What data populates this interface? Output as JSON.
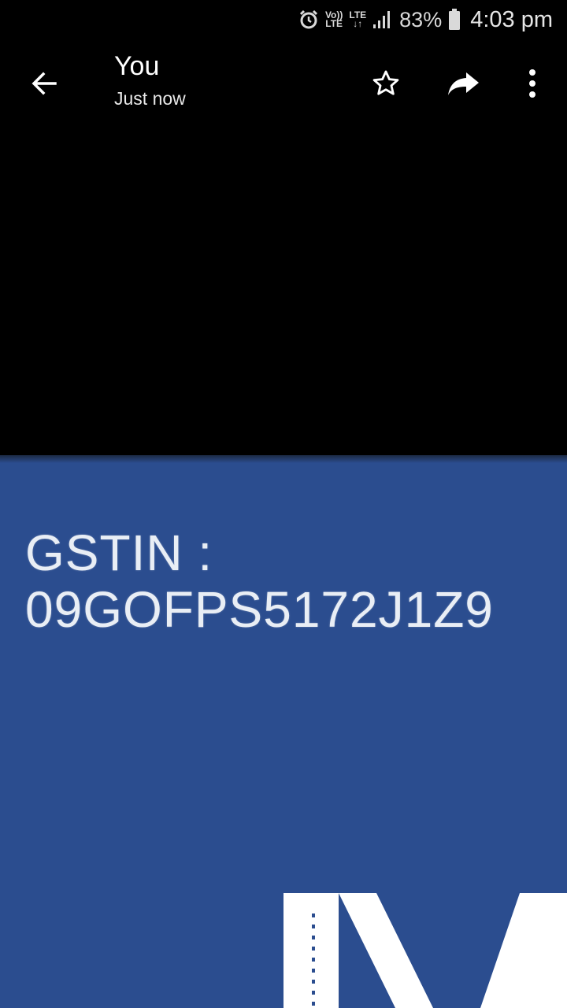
{
  "status_bar": {
    "volte_top": "Vo))",
    "volte_bottom": "LTE",
    "lte_top": "LTE",
    "lte_bottom": "↓↑",
    "battery": "83%",
    "time": "4:03 pm"
  },
  "toolbar": {
    "title": "You",
    "subtitle": "Just now",
    "icons": [
      "back-arrow-icon",
      "star-icon",
      "share-icon",
      "more-vert-icon"
    ]
  },
  "image": {
    "line1": "GSTIN :",
    "line2": "09GOFPS5172J1Z9",
    "background_color": "#2b4d8f"
  },
  "colors": {
    "background": "#000000",
    "text": "#ffffff"
  }
}
